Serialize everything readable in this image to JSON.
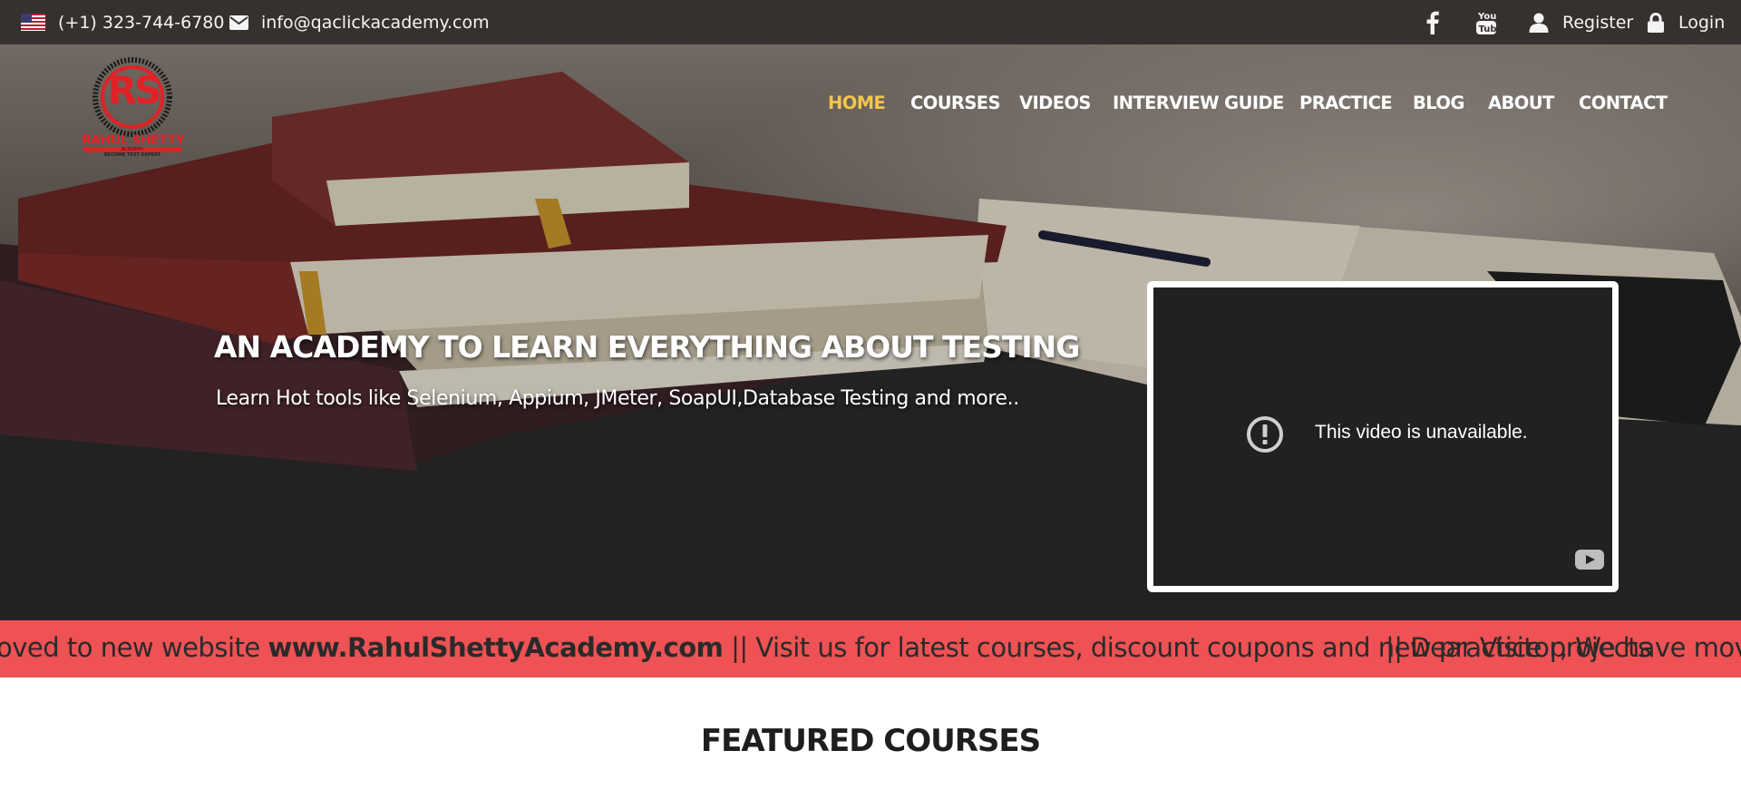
{
  "topbar": {
    "flag_icon": "us-flag-icon",
    "phone": "(+1) 323-744-6780",
    "email": "info@qaclickacademy.com",
    "register_label": "Register",
    "login_label": "Login",
    "icons": [
      "facebook-icon",
      "youtube-icon",
      "user-icon",
      "lock-icon",
      "envelope-icon"
    ]
  },
  "logo": {
    "initials": "RS",
    "name": "RAHUL SHETTY",
    "sub": "ACADEMY",
    "tagline": "BECOME TEST EXPERT",
    "color": "#e02227"
  },
  "nav": {
    "items": [
      "HOME",
      "COURSES",
      "VIDEOS",
      "INTERVIEW GUIDE",
      "PRACTICE",
      "BLOG",
      "ABOUT",
      "CONTACT"
    ],
    "active_color": "#f4c64b"
  },
  "hero": {
    "title": "AN ACADEMY TO LEARN EVERYTHING ABOUT TESTING",
    "subtitle": "Learn Hot tools like Selenium, Appium, JMeter, SoapUI,Database Testing and more.."
  },
  "video": {
    "message": "This video is unavailable.",
    "icons": [
      "exclamation-circle-icon",
      "youtube-logo-icon"
    ]
  },
  "ticker": {
    "before": "oved to new website ",
    "link": "www.RahulShettyAcademy.com",
    "after": " || Visit us for latest courses, discount coupons and new practice projects",
    "repeat": "|| Dear Visitor, We have moved",
    "background": "#ee5254"
  },
  "featured": {
    "heading": "FEATURED COURSES"
  }
}
